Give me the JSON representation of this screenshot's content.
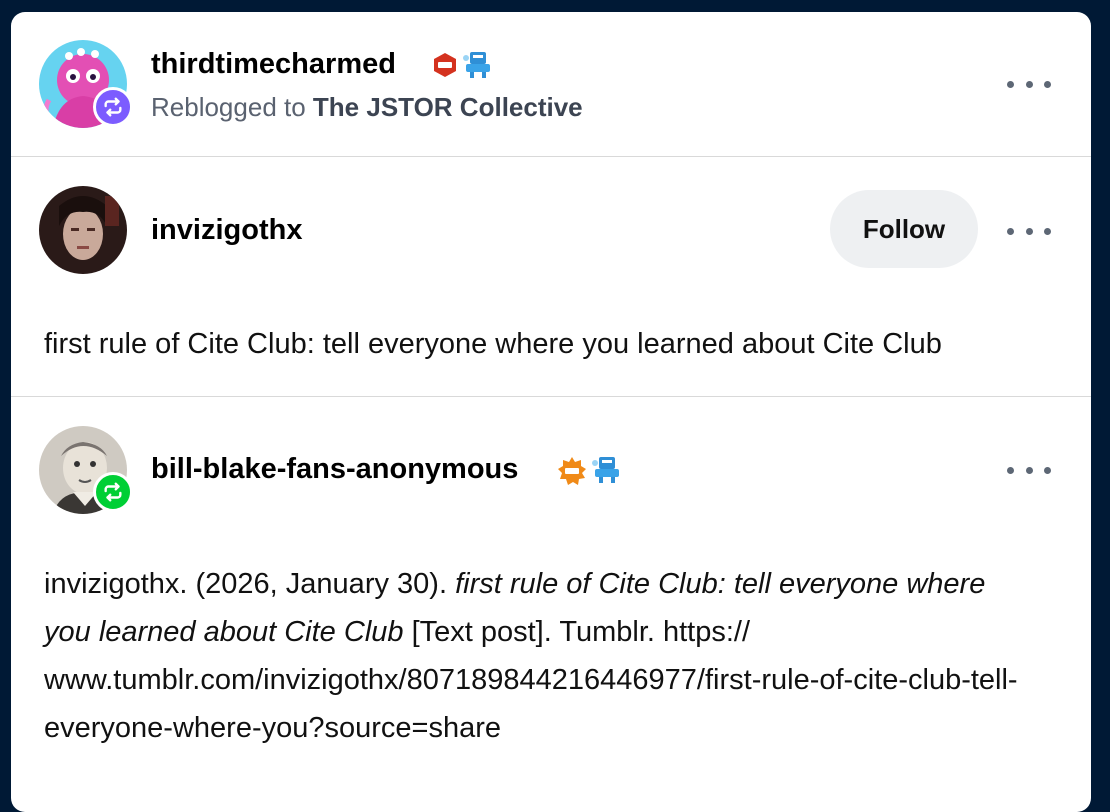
{
  "reblog_header": {
    "username": "thirdtimecharmed",
    "reblogged_prefix": "Reblogged to",
    "reblogged_target": "The JSTOR Collective"
  },
  "post": {
    "username": "invizigothx",
    "follow_label": "Follow",
    "text": "first rule of Cite Club: tell everyone where you learned about Cite Club"
  },
  "reblog": {
    "username": "bill-blake-fans-anonymous",
    "citation_prefix": "invizigothx. (2026, January 30). ",
    "citation_title": "first rule of Cite Club: tell everyone where you learned about Cite Club",
    "citation_suffix": " [Text post]. Tumblr. https:// www.tumblr.com/invizigothx/807189844216446977/first-rule-of-cite-club-tell-everyone-where-you?source=share"
  },
  "colors": {
    "background": "#001935",
    "reblog_badge_purple": "#7c5cff",
    "reblog_badge_green": "#00cf35"
  },
  "icons": {
    "reblog_badge": "reblog-arrows-icon",
    "more": "more-options-icon",
    "mini_badges": [
      "red-hexagon-badge-icon",
      "blue-robot-badge-icon",
      "orange-sun-badge-icon"
    ]
  }
}
